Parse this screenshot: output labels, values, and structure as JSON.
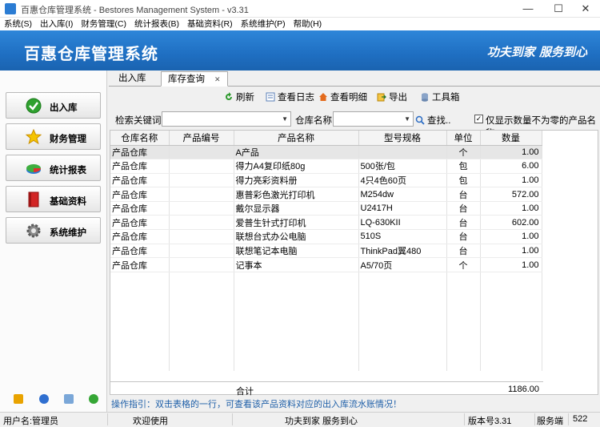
{
  "window": {
    "title": "百惠仓库管理系统 - Bestores Management System - v3.31",
    "minimize": "—",
    "maximize": "☐",
    "close": "✕"
  },
  "menu": [
    "系统(S)",
    "出入库(I)",
    "财务管理(C)",
    "统计报表(B)",
    "基础资料(R)",
    "系统维护(P)",
    "帮助(H)"
  ],
  "banner": {
    "title": "百惠仓库管理系统",
    "slogan": "功夫到家 服务到心"
  },
  "sidebar": {
    "items": [
      {
        "label": "出入库",
        "icon": "check-icon"
      },
      {
        "label": "财务管理",
        "icon": "star-icon"
      },
      {
        "label": "统计报表",
        "icon": "pie-chart-icon"
      },
      {
        "label": "基础资料",
        "icon": "book-icon"
      },
      {
        "label": "系统维护",
        "icon": "gear-icon"
      }
    ]
  },
  "tabs": [
    {
      "label": "出入库"
    },
    {
      "label": "库存查询",
      "close": "✕"
    }
  ],
  "toolbar": {
    "refresh": "刷新",
    "view_log": "查看日志",
    "view_detail": "查看明细",
    "export": "导出",
    "toolbox": "工具箱"
  },
  "search": {
    "keyword_label": "检索关键词",
    "keyword_value": "",
    "warehouse_label": "仓库名称",
    "warehouse_value": "",
    "search_button": "查找..",
    "only_nonzero_label": "仅显示数量不为零的产品名称",
    "only_nonzero_checked": true
  },
  "table": {
    "columns": [
      "仓库名称",
      "产品编号",
      "产品名称",
      "型号规格",
      "单位",
      "数量"
    ],
    "rows": [
      [
        "产品仓库",
        "",
        "A产品",
        "",
        "个",
        "1.00"
      ],
      [
        "产品仓库",
        "",
        "得力A4复印纸80g",
        "500张/包",
        "包",
        "6.00"
      ],
      [
        "产品仓库",
        "",
        "得力亮彩资料册",
        "4只4色60页",
        "包",
        "1.00"
      ],
      [
        "产品仓库",
        "",
        "惠普彩色激光打印机",
        "M254dw",
        "台",
        "572.00"
      ],
      [
        "产品仓库",
        "",
        "戴尔显示器",
        "U2417H",
        "台",
        "1.00"
      ],
      [
        "产品仓库",
        "",
        "爱普生针式打印机",
        "LQ-630KII",
        "台",
        "602.00"
      ],
      [
        "产品仓库",
        "",
        "联想台式办公电脑",
        "510S",
        "台",
        "1.00"
      ],
      [
        "产品仓库",
        "",
        "联想笔记本电脑",
        "ThinkPad翼480",
        "台",
        "1.00"
      ],
      [
        "产品仓库",
        "",
        "记事本",
        "A5/70页",
        "个",
        "1.00"
      ]
    ],
    "total_label": "合计",
    "total_value": "1186.00"
  },
  "hint": "操作指引：双击表格的一行，可查看该产品资料对应的出入库流水账情况！",
  "status": {
    "user": "用户名:管理员",
    "welcome": "欢迎使用",
    "motto": "功夫到家 服务到心",
    "version": "版本号3.31",
    "service": "服务端",
    "port": "522"
  },
  "colors": {
    "banner": "#1f6fc2",
    "hint": "#1e5fa8"
  }
}
